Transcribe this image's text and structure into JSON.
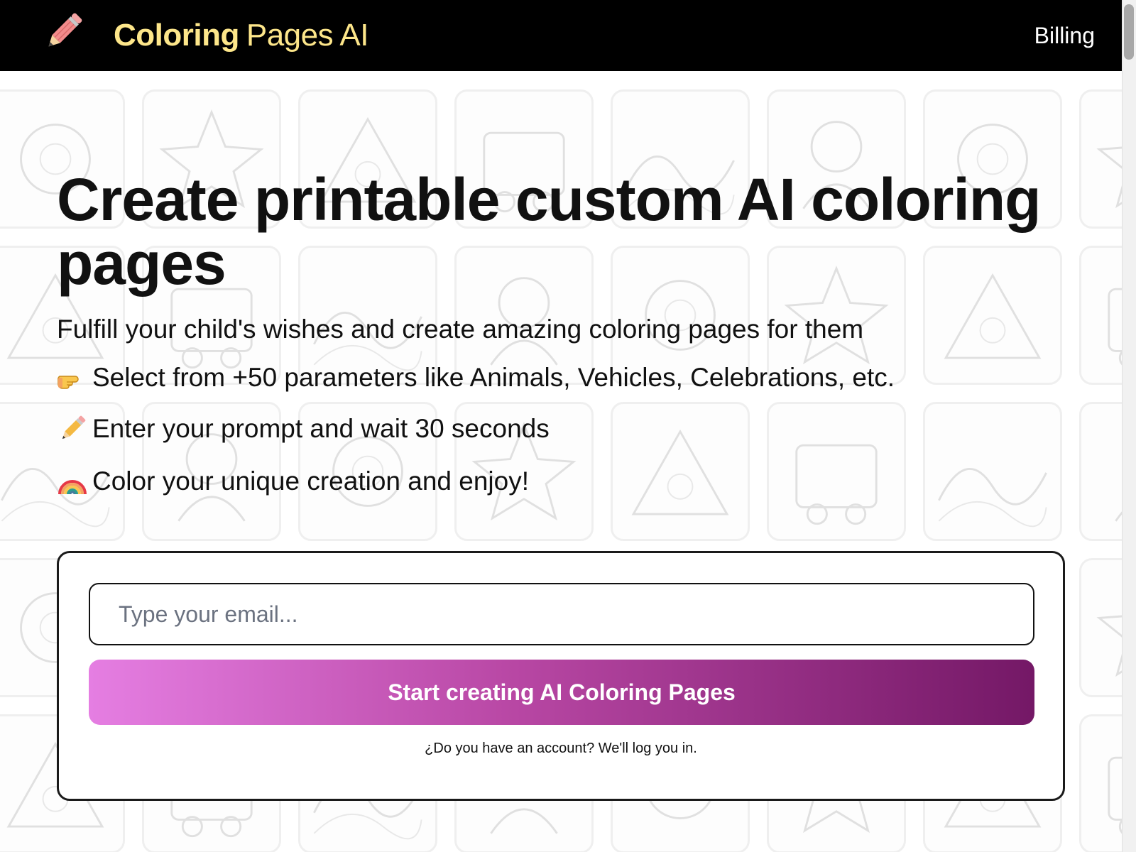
{
  "header": {
    "brand_strong": "Coloring",
    "brand_light": "Pages AI",
    "billing_link": "Billing",
    "logo_icon": "pencil-icon"
  },
  "hero": {
    "title": "Create printable custom AI coloring pages",
    "subtitle": "Fulfill your child's wishes and create amazing coloring pages for them",
    "features": [
      {
        "icon": "pointing-hand-icon",
        "text": "Select from +50 parameters like Animals, Vehicles, Celebrations, etc."
      },
      {
        "icon": "pencil-icon",
        "text": "Enter your prompt and wait 30 seconds"
      },
      {
        "icon": "rainbow-icon",
        "text": "Color your unique creation and enjoy!"
      }
    ]
  },
  "signup": {
    "email_placeholder": "Type your email...",
    "email_value": "",
    "cta_label": "Start creating AI Coloring Pages",
    "login_note": "¿Do you have an account? We'll log you in."
  },
  "colors": {
    "header_bg": "#000000",
    "brand_yellow": "#fde68a",
    "cta_gradient_start": "#e57ee2",
    "cta_gradient_end": "#741866"
  }
}
